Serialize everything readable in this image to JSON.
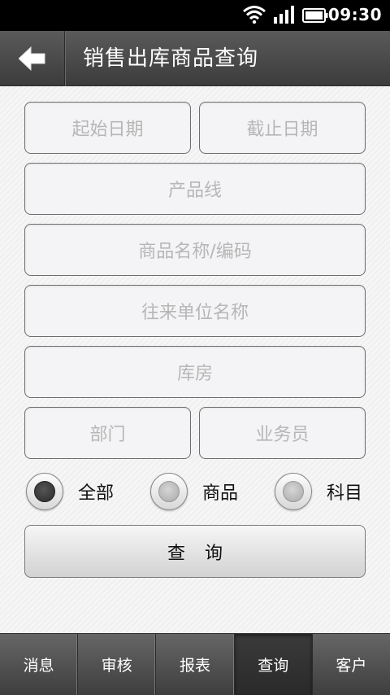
{
  "status_bar": {
    "time": "09:30",
    "icons": [
      "wifi-icon",
      "signal-icon",
      "battery-icon"
    ]
  },
  "header": {
    "title": "销售出库商品查询",
    "back_icon": "arrow-left-icon"
  },
  "form": {
    "start_date_placeholder": "起始日期",
    "end_date_placeholder": "截止日期",
    "product_line_placeholder": "产品线",
    "product_name_placeholder": "商品名称/编码",
    "partner_name_placeholder": "往来单位名称",
    "warehouse_placeholder": "库房",
    "department_placeholder": "部门",
    "salesperson_placeholder": "业务员",
    "radio_options": [
      {
        "label": "全部",
        "selected": true
      },
      {
        "label": "商品",
        "selected": false
      },
      {
        "label": "科目",
        "selected": false
      }
    ],
    "query_button": "查询"
  },
  "bottom_nav": {
    "tabs": [
      {
        "label": "消息",
        "active": false
      },
      {
        "label": "审核",
        "active": false
      },
      {
        "label": "报表",
        "active": false
      },
      {
        "label": "查询",
        "active": true
      },
      {
        "label": "客户",
        "active": false
      }
    ]
  },
  "colors": {
    "title_bar": "#4a4a4a",
    "field_border": "#6e6e6e",
    "placeholder": "#b6b6b6"
  }
}
